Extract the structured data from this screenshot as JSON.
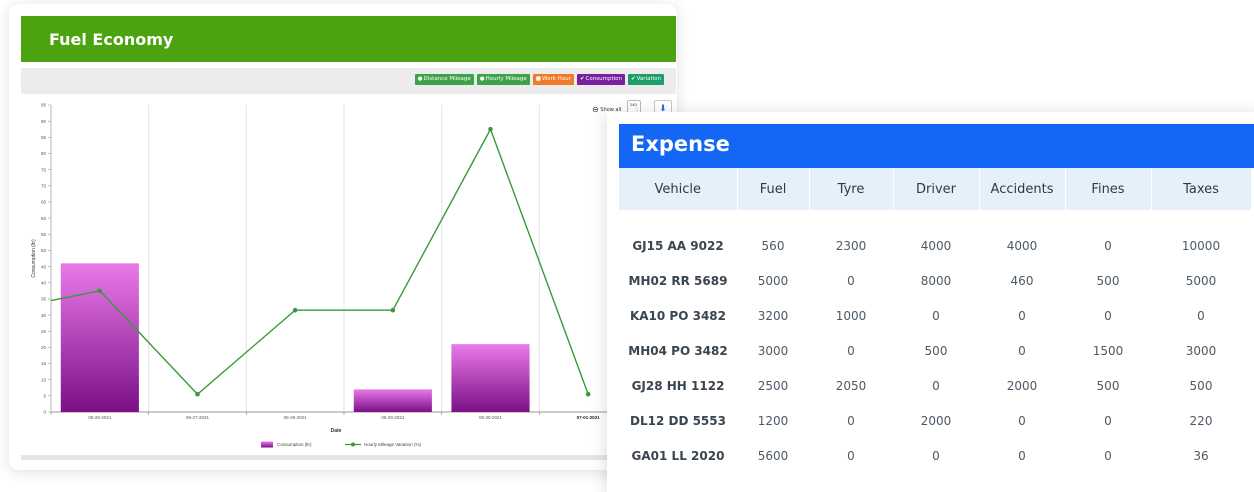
{
  "fuel_economy": {
    "title": "Fuel Economy",
    "legend_buttons": [
      {
        "label": "Distance Mileage",
        "icon": "●",
        "color": "#3ca34a"
      },
      {
        "label": "Hourly Mileage",
        "icon": "●",
        "color": "#3ca34a"
      },
      {
        "label": "Work Hour",
        "icon": "■",
        "color": "#f07a2a"
      },
      {
        "label": "Consumption",
        "icon": "✔",
        "color": "#7a1f9e"
      },
      {
        "label": "Variation",
        "icon": "✔",
        "color": "#1e9c6a"
      }
    ],
    "show_all": "Show all",
    "side_value": "240",
    "chart_data": {
      "type": "bar",
      "xlabel": "Date",
      "ylabel": "Consumption (ltr)",
      "ylim": [
        0,
        95
      ],
      "yticks": [
        0,
        5,
        10,
        15,
        20,
        25,
        30,
        35,
        40,
        45,
        50,
        55,
        60,
        65,
        70,
        75,
        80,
        85,
        90,
        95
      ],
      "categories": [
        "06-26-2021",
        "06-27-2021",
        "06-28-2021",
        "06-29-2021",
        "06-30-2021",
        "07-01-2021"
      ],
      "series": [
        {
          "name": "Consumption (ltr)",
          "type": "bar",
          "color": "#8a1a98",
          "values": [
            46,
            0,
            0,
            7,
            21,
            0
          ]
        },
        {
          "name": "Hourly Mileage Variation (%)",
          "type": "line",
          "color": "#3a9a3a",
          "values": [
            37.5,
            5.5,
            31.5,
            31.5,
            87.5,
            5.5
          ],
          "start_value": 34.5
        }
      ],
      "grid": "vertical",
      "legend": "bottom"
    }
  },
  "expense": {
    "title": "Expense",
    "columns": [
      "Vehicle",
      "Fuel",
      "Tyre",
      "Driver",
      "Accidents",
      "Fines",
      "Taxes"
    ],
    "rows": [
      [
        "GJ15 AA 9022",
        "560",
        "2300",
        "4000",
        "4000",
        "0",
        "10000"
      ],
      [
        "MH02 RR 5689",
        "5000",
        "0",
        "8000",
        "460",
        "500",
        "5000"
      ],
      [
        "KA10 PO 3482",
        "3200",
        "1000",
        "0",
        "0",
        "0",
        "0"
      ],
      [
        "MH04 PO 3482",
        "3000",
        "0",
        "500",
        "0",
        "1500",
        "3000"
      ],
      [
        "GJ28 HH 1122",
        "2500",
        "2050",
        "0",
        "2000",
        "500",
        "500"
      ],
      [
        "DL12 DD 5553",
        "1200",
        "0",
        "2000",
        "0",
        "0",
        "220"
      ],
      [
        "GA01 LL 2020",
        "5600",
        "0",
        "0",
        "0",
        "0",
        "36"
      ]
    ]
  }
}
